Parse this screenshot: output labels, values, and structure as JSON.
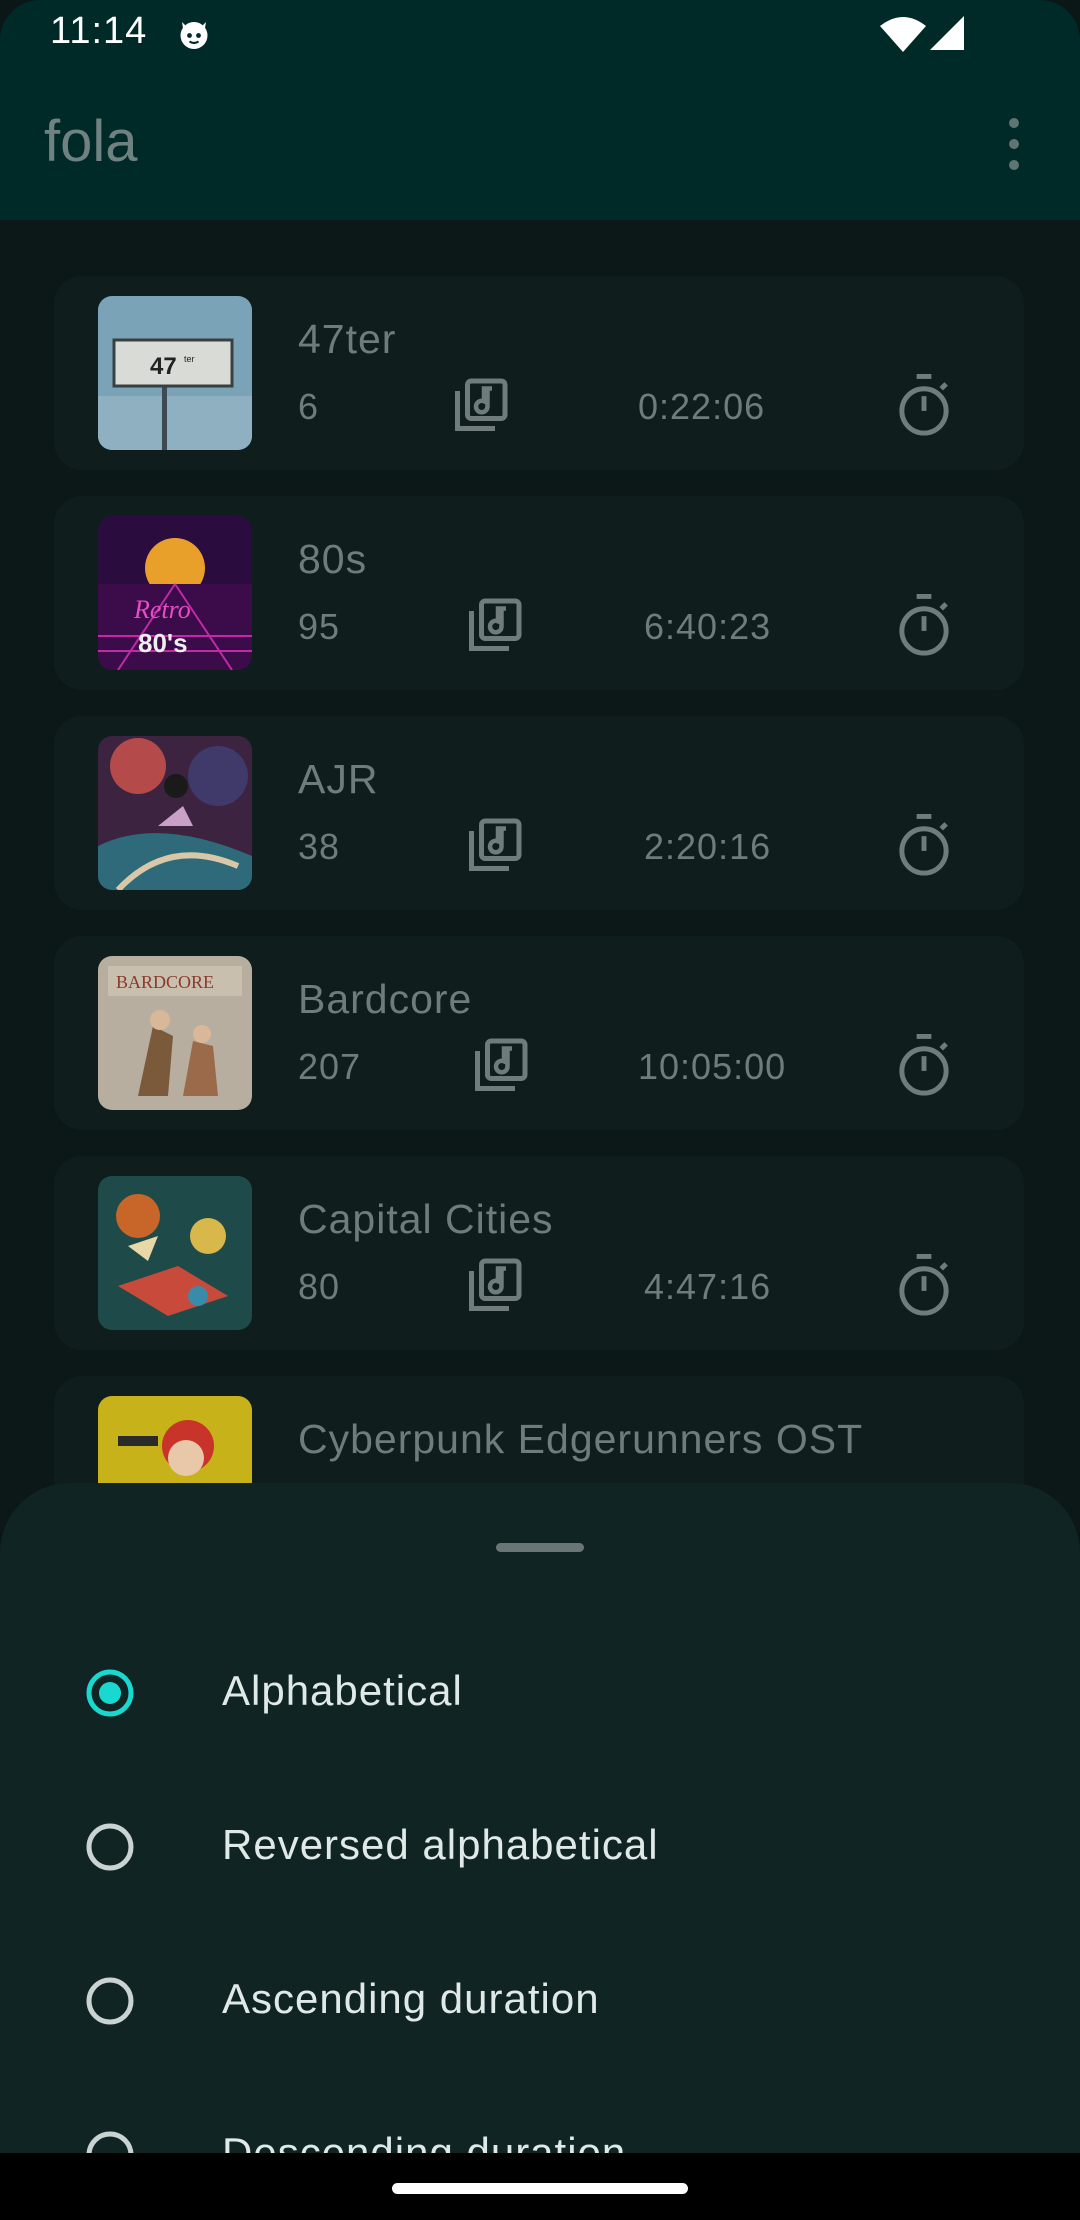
{
  "status_bar": {
    "time": "11:14",
    "icons": [
      "cat-notification-icon",
      "wifi-icon",
      "signal-icon"
    ]
  },
  "app_bar": {
    "title": "fola",
    "menu_icon": "more-vert-icon"
  },
  "playlists": [
    {
      "name": "47ter",
      "track_count": "6",
      "duration": "0:22:06",
      "cover": "billboard-47ter"
    },
    {
      "name": "80s",
      "track_count": "95",
      "duration": "6:40:23",
      "cover": "retro-80s-sunset"
    },
    {
      "name": "AJR",
      "track_count": "38",
      "duration": "2:20:16",
      "cover": "ajr-colorful-art"
    },
    {
      "name": "Bardcore",
      "track_count": "207",
      "duration": "10:05:00",
      "cover": "bardcore-medieval"
    },
    {
      "name": "Capital Cities",
      "track_count": "80",
      "duration": "4:47:16",
      "cover": "capital-cities-illustration"
    },
    {
      "name": "Cyberpunk Edgerunners OST",
      "track_count": "",
      "duration": "",
      "cover": "cyberpunk-character"
    }
  ],
  "sort_sheet": {
    "options": [
      {
        "label": "Alphabetical",
        "selected": true
      },
      {
        "label": "Reversed alphabetical",
        "selected": false
      },
      {
        "label": "Ascending duration",
        "selected": false
      },
      {
        "label": "Descending duration",
        "selected": false
      }
    ]
  },
  "colors": {
    "app_bar": "#002a28",
    "background": "#0c1818",
    "card": "#0f1d1d",
    "sheet": "#112424",
    "accent": "#19d8d0",
    "muted_text": "#6f7c7b"
  }
}
